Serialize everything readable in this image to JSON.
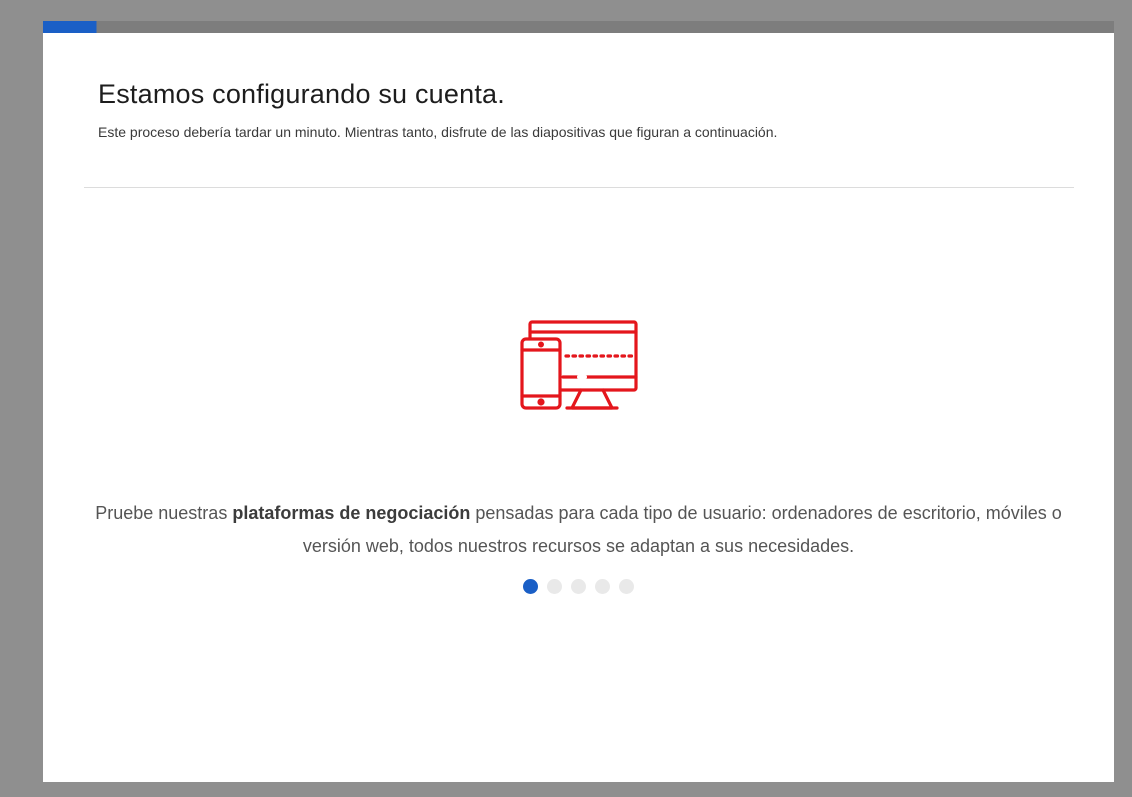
{
  "modal": {
    "title": "Estamos configurando su cuenta.",
    "subtitle": "Este proceso debería tardar un minuto. Mientras tanto, disfrute de las diapositivas que figuran a continuación.",
    "progress": 0.05
  },
  "slide": {
    "icon": "devices-icon",
    "text_before": "Pruebe nuestras ",
    "text_bold": "plataformas de negociación",
    "text_after": " pensadas para cada tipo de usuario: ordenadores de escritorio, móviles o versión web, todos nuestros recursos se adaptan a sus necesidades."
  },
  "carousel": {
    "total": 5,
    "active_index": 0
  },
  "colors": {
    "accent": "#1a5fc6",
    "icon": "#e4161c",
    "backdrop": "#8f8f8f"
  }
}
